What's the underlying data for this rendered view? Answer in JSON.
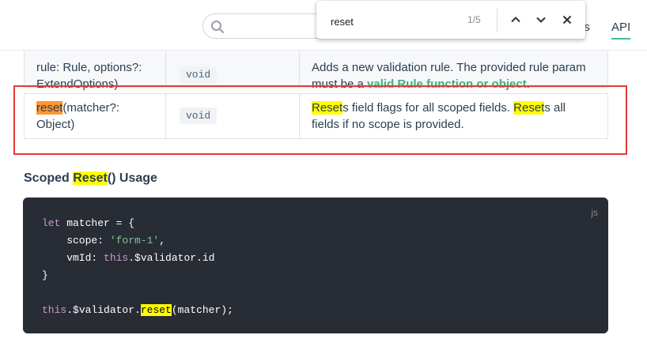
{
  "header": {
    "search_placeholder": "",
    "nav_partial": "es",
    "nav_api": "API"
  },
  "find_bar": {
    "query": "reset",
    "count": "1/5"
  },
  "table": {
    "row1": {
      "sig": "rule: Rule, options?: ExtendOptions)",
      "ret": "void",
      "desc_pre": "Adds a new validation rule. The provided rule param must be a ",
      "desc_link": "valid Rule function or object",
      "desc_post": "."
    },
    "row2": {
      "sig_match": "reset",
      "sig_rest": "(matcher?: Object)",
      "ret": "void",
      "desc_m1": "Reset",
      "desc_p1": "s field flags for all scoped fields. ",
      "desc_m2": "Reset",
      "desc_p2": "s all fields if no scope is provided."
    }
  },
  "section": {
    "pre": "Scoped ",
    "match": "Reset",
    "post": "() Usage"
  },
  "code": {
    "lang": "js",
    "l1_kw": "let",
    "l1_rest": " matcher = {",
    "l2_key": "    scope: ",
    "l2_str": "'form-1'",
    "l2_end": ",",
    "l3_key": "    vmId: ",
    "l3_kw": "this",
    "l3_rest": ".$validator.id",
    "l4": "}",
    "l6_kw": "this",
    "l6_a": ".$validator.",
    "l6_match": "reset",
    "l6_b": "(matcher);"
  }
}
